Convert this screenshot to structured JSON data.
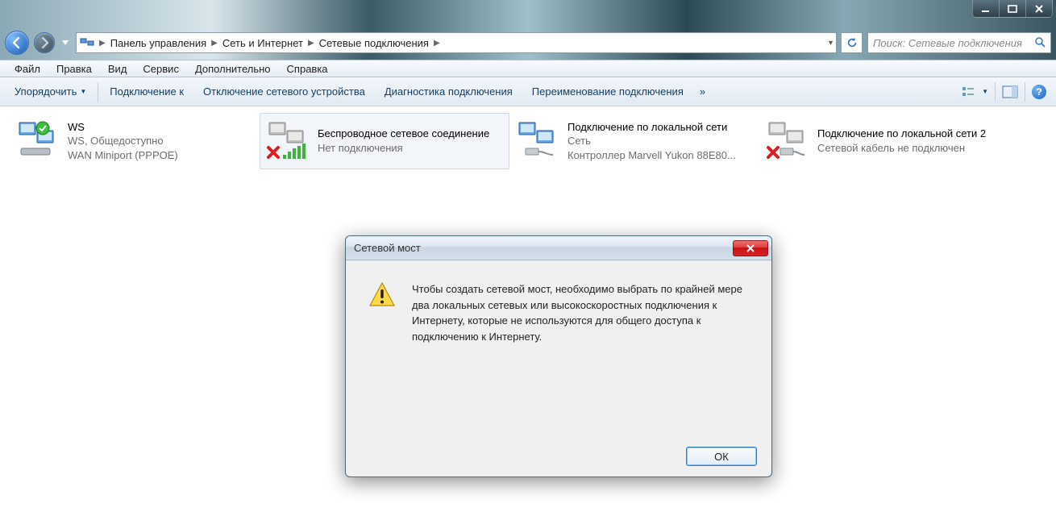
{
  "window": {
    "controls": {
      "min": "min",
      "max": "max",
      "close": "close"
    }
  },
  "breadcrumbs": {
    "items": [
      "Панель управления",
      "Сеть и Интернет",
      "Сетевые подключения"
    ]
  },
  "search": {
    "placeholder": "Поиск: Сетевые подключения"
  },
  "menu": {
    "items": [
      "Файл",
      "Правка",
      "Вид",
      "Сервис",
      "Дополнительно",
      "Справка"
    ]
  },
  "toolbar": {
    "organize": "Упорядочить",
    "connect": "Подключение к",
    "disable": "Отключение сетевого устройства",
    "diagnose": "Диагностика подключения",
    "rename": "Переименование подключения",
    "overflow": "»"
  },
  "connections": [
    {
      "name": "WS",
      "line2": "WS, Общедоступно",
      "line3": "WAN Miniport (PPPOE)",
      "icon": "dialup-ok",
      "selected": false
    },
    {
      "name": "Беспроводное сетевое соединение",
      "line2": "Нет подключения",
      "line3": "",
      "icon": "wifi-x",
      "selected": true
    },
    {
      "name": "Подключение по локальной сети",
      "line2": "Сеть",
      "line3": "Контроллер Marvell Yukon 88E80...",
      "icon": "lan-ok",
      "selected": false
    },
    {
      "name": "Подключение по локальной сети 2",
      "line2": "Сетевой кабель не подключен",
      "line3": "",
      "icon": "lan-x",
      "selected": false
    }
  ],
  "dialog": {
    "title": "Сетевой мост",
    "message": "Чтобы создать сетевой мост, необходимо выбрать по крайней мере два локальных сетевых или высокоскоростных подключения к Интернету, которые не используются для общего доступа к подключению к Интернету.",
    "ok": "ОК"
  }
}
